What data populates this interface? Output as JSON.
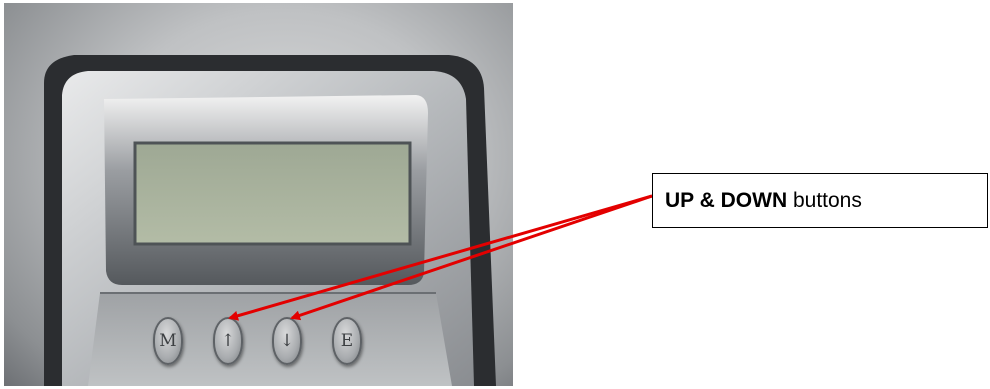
{
  "photo": {
    "buttons": [
      {
        "glyph": "M"
      },
      {
        "glyph": "↑"
      },
      {
        "glyph": "↓"
      },
      {
        "glyph": "E"
      }
    ]
  },
  "callout": {
    "bold_text": "UP & DOWN",
    "rest_text": " buttons"
  },
  "colors": {
    "arrow": "#e30000",
    "lcd": "#a8b29a"
  }
}
